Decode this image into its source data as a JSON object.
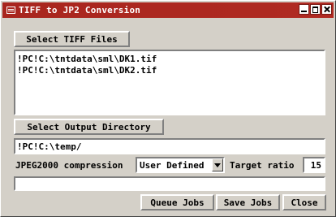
{
  "window": {
    "title": "TIFF to JP2 Conversion"
  },
  "select_files_button": "Select TIFF Files",
  "file_list": [
    "!PC!C:\\tntdata\\sml\\DK1.tif",
    "!PC!C:\\tntdata\\sml\\DK2.tif"
  ],
  "select_output_button": "Select Output Directory",
  "output_directory": "!PC!C:\\temp/",
  "compression": {
    "label": "JPEG2000 compression",
    "selected": "User Defined",
    "target_ratio_label": "Target ratio",
    "target_ratio_value": "15"
  },
  "status_text": "",
  "buttons": {
    "queue": "Queue Jobs",
    "save": "Save Jobs",
    "close": "Close"
  },
  "icons": {
    "window_icon": "window-menu-icon",
    "minimize": "minimize-icon",
    "maximize": "maximize-icon",
    "close": "close-icon",
    "dropdown": "chevron-down-icon"
  }
}
